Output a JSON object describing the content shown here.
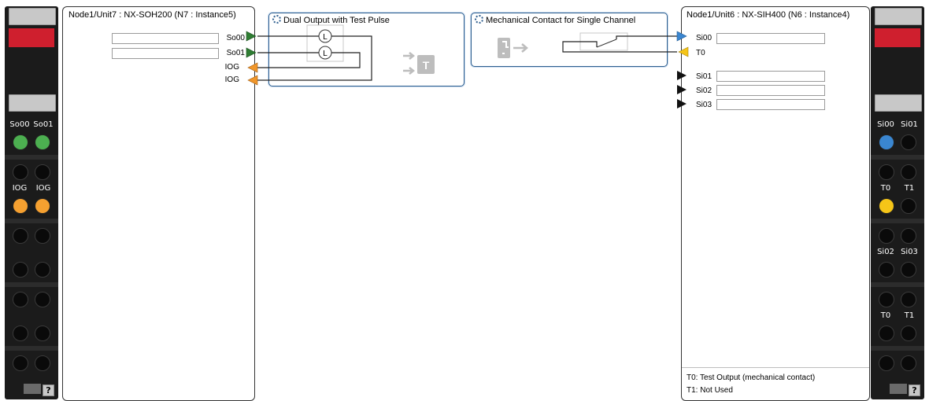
{
  "left_panel": {
    "title": "Node1/Unit7 : NX-SOH200 (N7 : Instance5)",
    "ports": [
      "So00",
      "So01",
      "IOG",
      "IOG"
    ],
    "port_colors": [
      "#2e7d32",
      "#2e7d32",
      "#f0962a",
      "#f0962a"
    ]
  },
  "right_panel": {
    "title": "Node1/Unit6 : NX-SIH400 (N6 : Instance4)",
    "ports": [
      "Si00",
      "T0",
      "Si01",
      "Si02",
      "Si03"
    ],
    "port_colors": [
      "#3a86d0",
      "#f5c518",
      "#000000",
      "#000000",
      "#000000"
    ],
    "notes": [
      "T0: Test Output (mechanical contact)",
      "T1: Not Used"
    ]
  },
  "function_block_1": {
    "title": "Dual Output with Test Pulse",
    "icon": "gear-icon",
    "output_icon_letter": "T",
    "lamp_letter": "L"
  },
  "function_block_2": {
    "title": "Mechanical Contact for Single Channel",
    "icon": "gear-icon"
  },
  "left_strip": {
    "term_labels": [
      [
        "So00",
        "So01"
      ],
      [
        "IOG",
        "IOG"
      ],
      [
        "",
        ""
      ],
      [
        "",
        ""
      ],
      [
        "",
        ""
      ],
      [
        "",
        ""
      ]
    ],
    "leds": [
      "#4caf50",
      "#4caf50",
      "#f5a030",
      "#f5a030"
    ],
    "help": "?"
  },
  "right_strip": {
    "term_labels": [
      [
        "Si00",
        "Si01"
      ],
      [
        "T0",
        "T1"
      ],
      [
        "Si02",
        "Si03"
      ],
      [
        "T0",
        "T1"
      ],
      [
        "",
        ""
      ],
      [
        "",
        ""
      ]
    ],
    "leds": [
      "#3a86d0",
      "#f5c518"
    ],
    "help": "?"
  },
  "colors": {
    "accent": "#2f5f8f",
    "red_indicator": "#cf1f2e"
  }
}
